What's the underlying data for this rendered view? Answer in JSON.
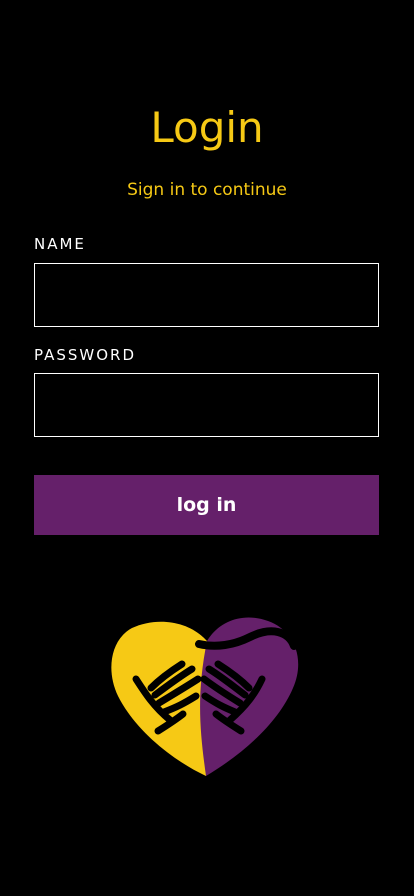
{
  "screen": {
    "title": "Login",
    "subtitle": "Sign in to continue"
  },
  "form": {
    "name_label": "NAME",
    "name_value": "",
    "password_label": "PASSWORD",
    "password_value": "",
    "submit_label": "log in"
  },
  "logo": {
    "icon": "heart-hands-logo",
    "colors": [
      "#f6c915",
      "#65206a",
      "#000000"
    ]
  },
  "theme": {
    "background": "#000000",
    "accent_yellow": "#f6c915",
    "button_purple": "#65206a",
    "text_white": "#ffffff"
  }
}
